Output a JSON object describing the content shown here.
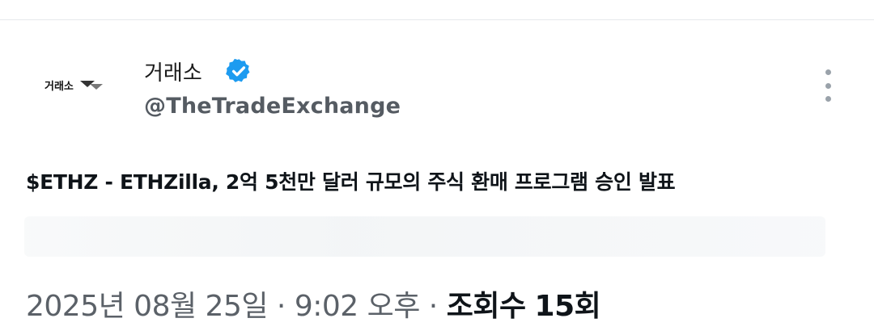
{
  "avatar": {
    "text": "거래소",
    "icon": "exchange-logo-mark"
  },
  "author": {
    "display_name": "거래소",
    "handle": "@TheTradeExchange",
    "verified_icon": "verified-badge-icon",
    "verified_color": "#1d9bf0"
  },
  "more_icon": "more-vertical-icon",
  "tweet": {
    "text": "$ETHZ - ETHZilla, 2억 5천만 달러 규모의 주식 환매 프로그램 승인 발표"
  },
  "meta": {
    "date": "2025년 08월 25일",
    "separator": " · ",
    "time": "9:02 오후",
    "views_label": "조회수",
    "views_count": "15회"
  }
}
